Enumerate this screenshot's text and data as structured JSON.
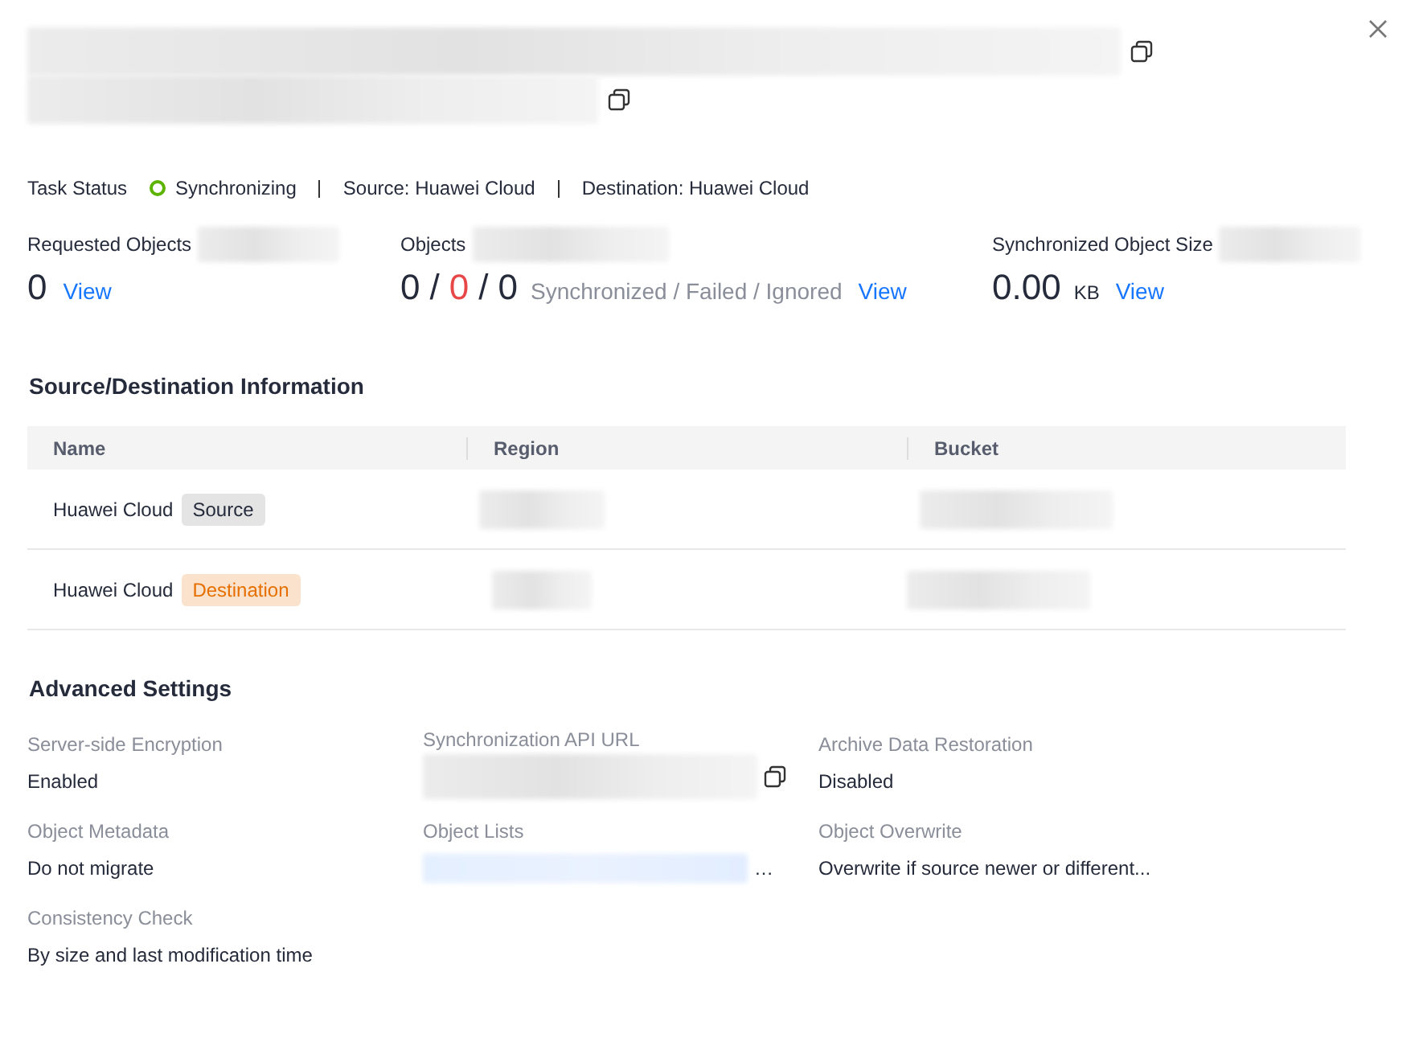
{
  "title_lines": [
    {
      "kind": "redacted",
      "copyable": true
    },
    {
      "kind": "redacted",
      "copyable": true
    }
  ],
  "task_status": {
    "label": "Task Status",
    "status": "Synchronizing",
    "color": "#5cb300",
    "source": "Source: Huawei Cloud",
    "destination": "Destination: Huawei Cloud"
  },
  "stats": [
    {
      "label": "Requested Objects",
      "numbers": [
        {
          "text": "0",
          "kind": "normal"
        }
      ],
      "link": "View"
    },
    {
      "label": "Objects",
      "numbers": [
        {
          "text": "0",
          "kind": "normal"
        },
        {
          "text": "/",
          "kind": "sep"
        },
        {
          "text": "0",
          "kind": "error"
        },
        {
          "text": "/",
          "kind": "sep"
        },
        {
          "text": "0",
          "kind": "normal"
        }
      ],
      "caption": "Synchronized / Failed / Ignored",
      "link": "View"
    },
    {
      "label": "Synchronized Object Size",
      "numbers": [
        {
          "text": "0.00",
          "kind": "normal"
        }
      ],
      "unit": "KB",
      "link": "View"
    }
  ],
  "source_destination": {
    "title": "Source/Destination Information",
    "columns": [
      "Name",
      "Region",
      "Bucket"
    ],
    "rows": [
      {
        "name": "Huawei Cloud",
        "tag": "Source",
        "color": "#252b3a"
      },
      {
        "name": "Huawei Cloud",
        "tag": "Destination",
        "color": "#e66f00"
      }
    ]
  },
  "advanced": {
    "title": "Advanced Settings",
    "items": [
      {
        "label": "Server-side Encryption",
        "kind": "text",
        "value": "Enabled"
      },
      {
        "label": "Synchronization API URL",
        "kind": "redacted",
        "copyable": true
      },
      {
        "label": "Archive Data Restoration",
        "kind": "text",
        "value": "Disabled"
      },
      {
        "label": "Object Metadata",
        "kind": "text",
        "value": "Do not migrate"
      },
      {
        "label": "Object Lists",
        "kind": "redacted-link",
        "value": "…"
      },
      {
        "label": "Object Overwrite",
        "kind": "text",
        "value": "Overwrite if source newer or different..."
      },
      {
        "label": "Consistency Check",
        "kind": "text",
        "value": "By size and last modification time"
      }
    ]
  }
}
